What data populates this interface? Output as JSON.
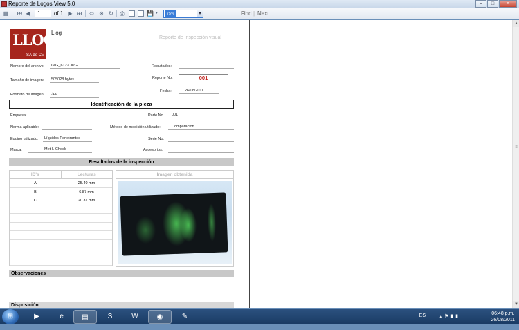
{
  "window": {
    "title": "Reporte de Logos View 5.0"
  },
  "toolbar": {
    "current_page": "1",
    "of_label": "of 1",
    "zoom": "75%",
    "find_label": "Find",
    "next_label": "Next"
  },
  "report": {
    "logo_text": "LLOG",
    "logo_sub": "SA de CV",
    "company": "Llog",
    "title": "Reporte de Inspección visual",
    "fields": {
      "file_name_label": "Nombre del archivo:",
      "file_name": "IMG_6122.JPG",
      "image_size_label": "Tamaño de imagen:",
      "image_size": "505028 bytes",
      "image_format_label": "Formato de imagen:",
      "image_format": ".jpg",
      "results_label": "Resultados:",
      "report_no_label": "Reporte No.",
      "report_no": "001",
      "date_label": "Fecha:",
      "date": "26/08/2011"
    },
    "piece_section": "Identificación de la pieza",
    "piece": {
      "company_label": "Empresa:",
      "part_no_label": "Parte No.",
      "part_no": "001",
      "norm_label": "Norma aplicable:",
      "method_label": "Método de medición utilizado:",
      "method": "Comparación",
      "equipment_label": "Equipo utilizado:",
      "equipment": "Líquidos Penetrantes",
      "serial_label": "Serie No.",
      "brand_label": "Marca:",
      "brand": "Met-L-Check",
      "accessories_label": "Accesorios:"
    },
    "results_section": "Resultados de la inspección",
    "table": {
      "col_ids": "ID's",
      "col_readings": "Lecturas",
      "rows": [
        {
          "id": "A",
          "reading": "25.40 mm"
        },
        {
          "id": "B",
          "reading": "6.87 mm"
        },
        {
          "id": "C",
          "reading": "20.31 mm"
        }
      ]
    },
    "image_header": "Imagen obtenida",
    "observations": "Observaciones",
    "disposition": "Disposición"
  },
  "taskbar": {
    "lang": "ES",
    "time": "06:48 p.m.",
    "date": "26/08/2011"
  }
}
